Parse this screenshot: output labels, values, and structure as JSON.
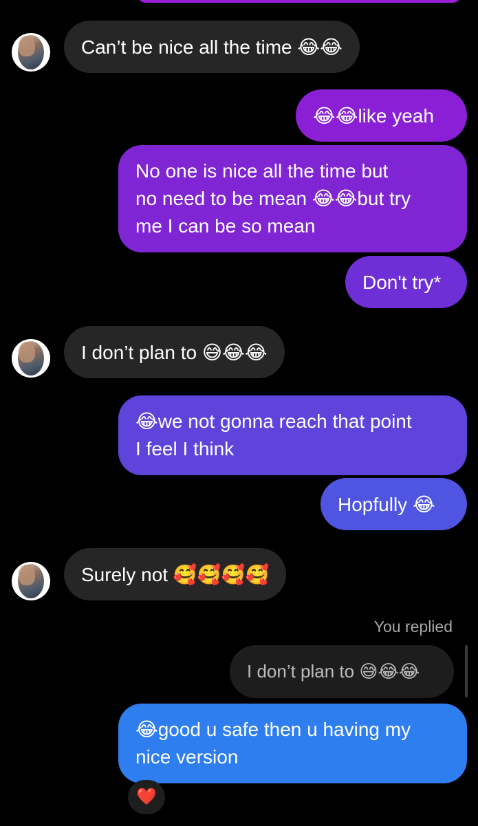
{
  "messages": [
    {
      "id": "m1",
      "dir": "in",
      "text": "Can’t be nice all the time",
      "emoji": "😂😂"
    },
    {
      "id": "m2",
      "dir": "out",
      "text": "like yeah",
      "emoji_prefix": "😂😂"
    },
    {
      "id": "m3",
      "dir": "out",
      "line1": "No one is nice all the time but",
      "line2a": "no need to be mean ",
      "emoji": "😂😂",
      "line2b": "but try",
      "line3": "me I can be so mean"
    },
    {
      "id": "m4",
      "dir": "out",
      "text": "Don't try*"
    },
    {
      "id": "m5",
      "dir": "in",
      "text": "I don’t plan to ",
      "emoji": "😅😂😂"
    },
    {
      "id": "m6",
      "dir": "out",
      "emoji_prefix": "😂",
      "line1": "we not gonna reach that point",
      "line2": "I feel I think"
    },
    {
      "id": "m7",
      "dir": "out",
      "text": "Hopfully ",
      "emoji": "😂"
    },
    {
      "id": "m8",
      "dir": "in",
      "text": "Surely not ",
      "emoji": "🥰🥰🥰🥰"
    },
    {
      "id": "m9",
      "dir": "out",
      "emoji_prefix": "😂",
      "line1": "good u safe then u having my",
      "line2": "nice version"
    }
  ],
  "reply": {
    "status": "You replied",
    "quoted_text": "I don’t plan to ",
    "quoted_emoji": "😅😂😂"
  },
  "reaction": {
    "icon": "heart-icon",
    "glyph": "❤️"
  },
  "colors": {
    "incoming": "#262626",
    "gradient_top": "#9b1fd6",
    "gradient_bottom": "#2f7ef0"
  }
}
